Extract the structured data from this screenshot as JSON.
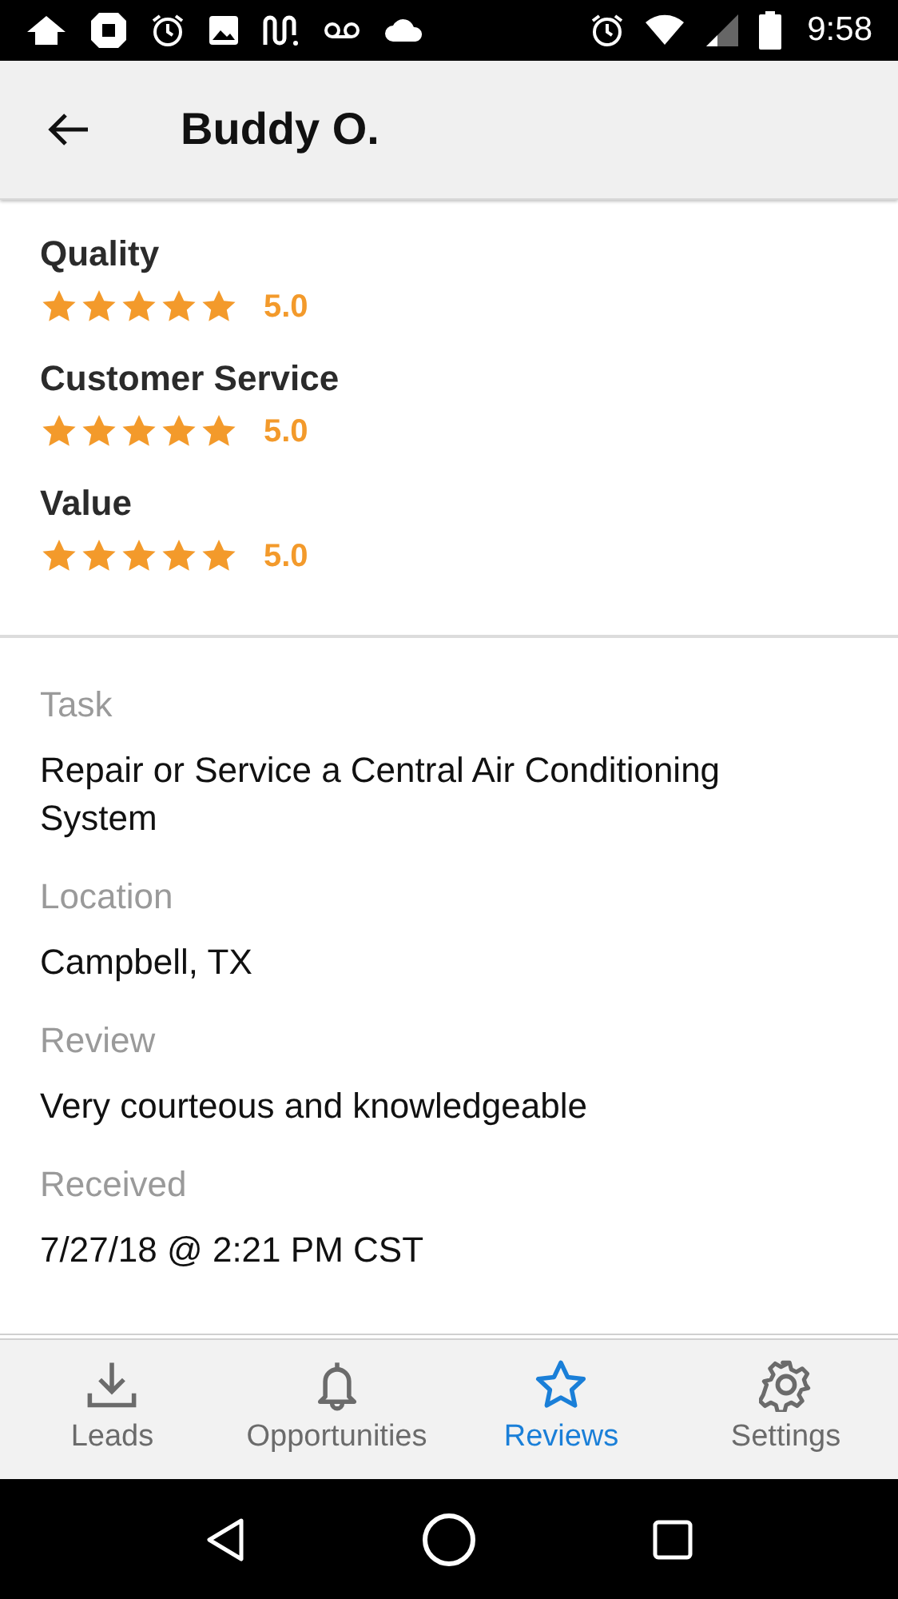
{
  "status_bar": {
    "time": "9:58"
  },
  "app_bar": {
    "title": "Buddy O."
  },
  "ratings": [
    {
      "label": "Quality",
      "stars": 5,
      "score": "5.0"
    },
    {
      "label": "Customer Service",
      "stars": 5,
      "score": "5.0"
    },
    {
      "label": "Value",
      "stars": 5,
      "score": "5.0"
    }
  ],
  "details": [
    {
      "label": "Task",
      "value": "Repair or Service a Central Air Conditioning System"
    },
    {
      "label": "Location",
      "value": "Campbell, TX"
    },
    {
      "label": "Review",
      "value": "Very courteous and knowledgeable"
    },
    {
      "label": "Received",
      "value": "7/27/18 @ 2:21 PM CST"
    }
  ],
  "tabs": [
    {
      "kind": "leads",
      "label": "Leads",
      "selected": false
    },
    {
      "kind": "opportunities",
      "label": "Opportunities",
      "selected": false
    },
    {
      "kind": "reviews",
      "label": "Reviews",
      "selected": true
    },
    {
      "kind": "settings",
      "label": "Settings",
      "selected": false
    }
  ]
}
